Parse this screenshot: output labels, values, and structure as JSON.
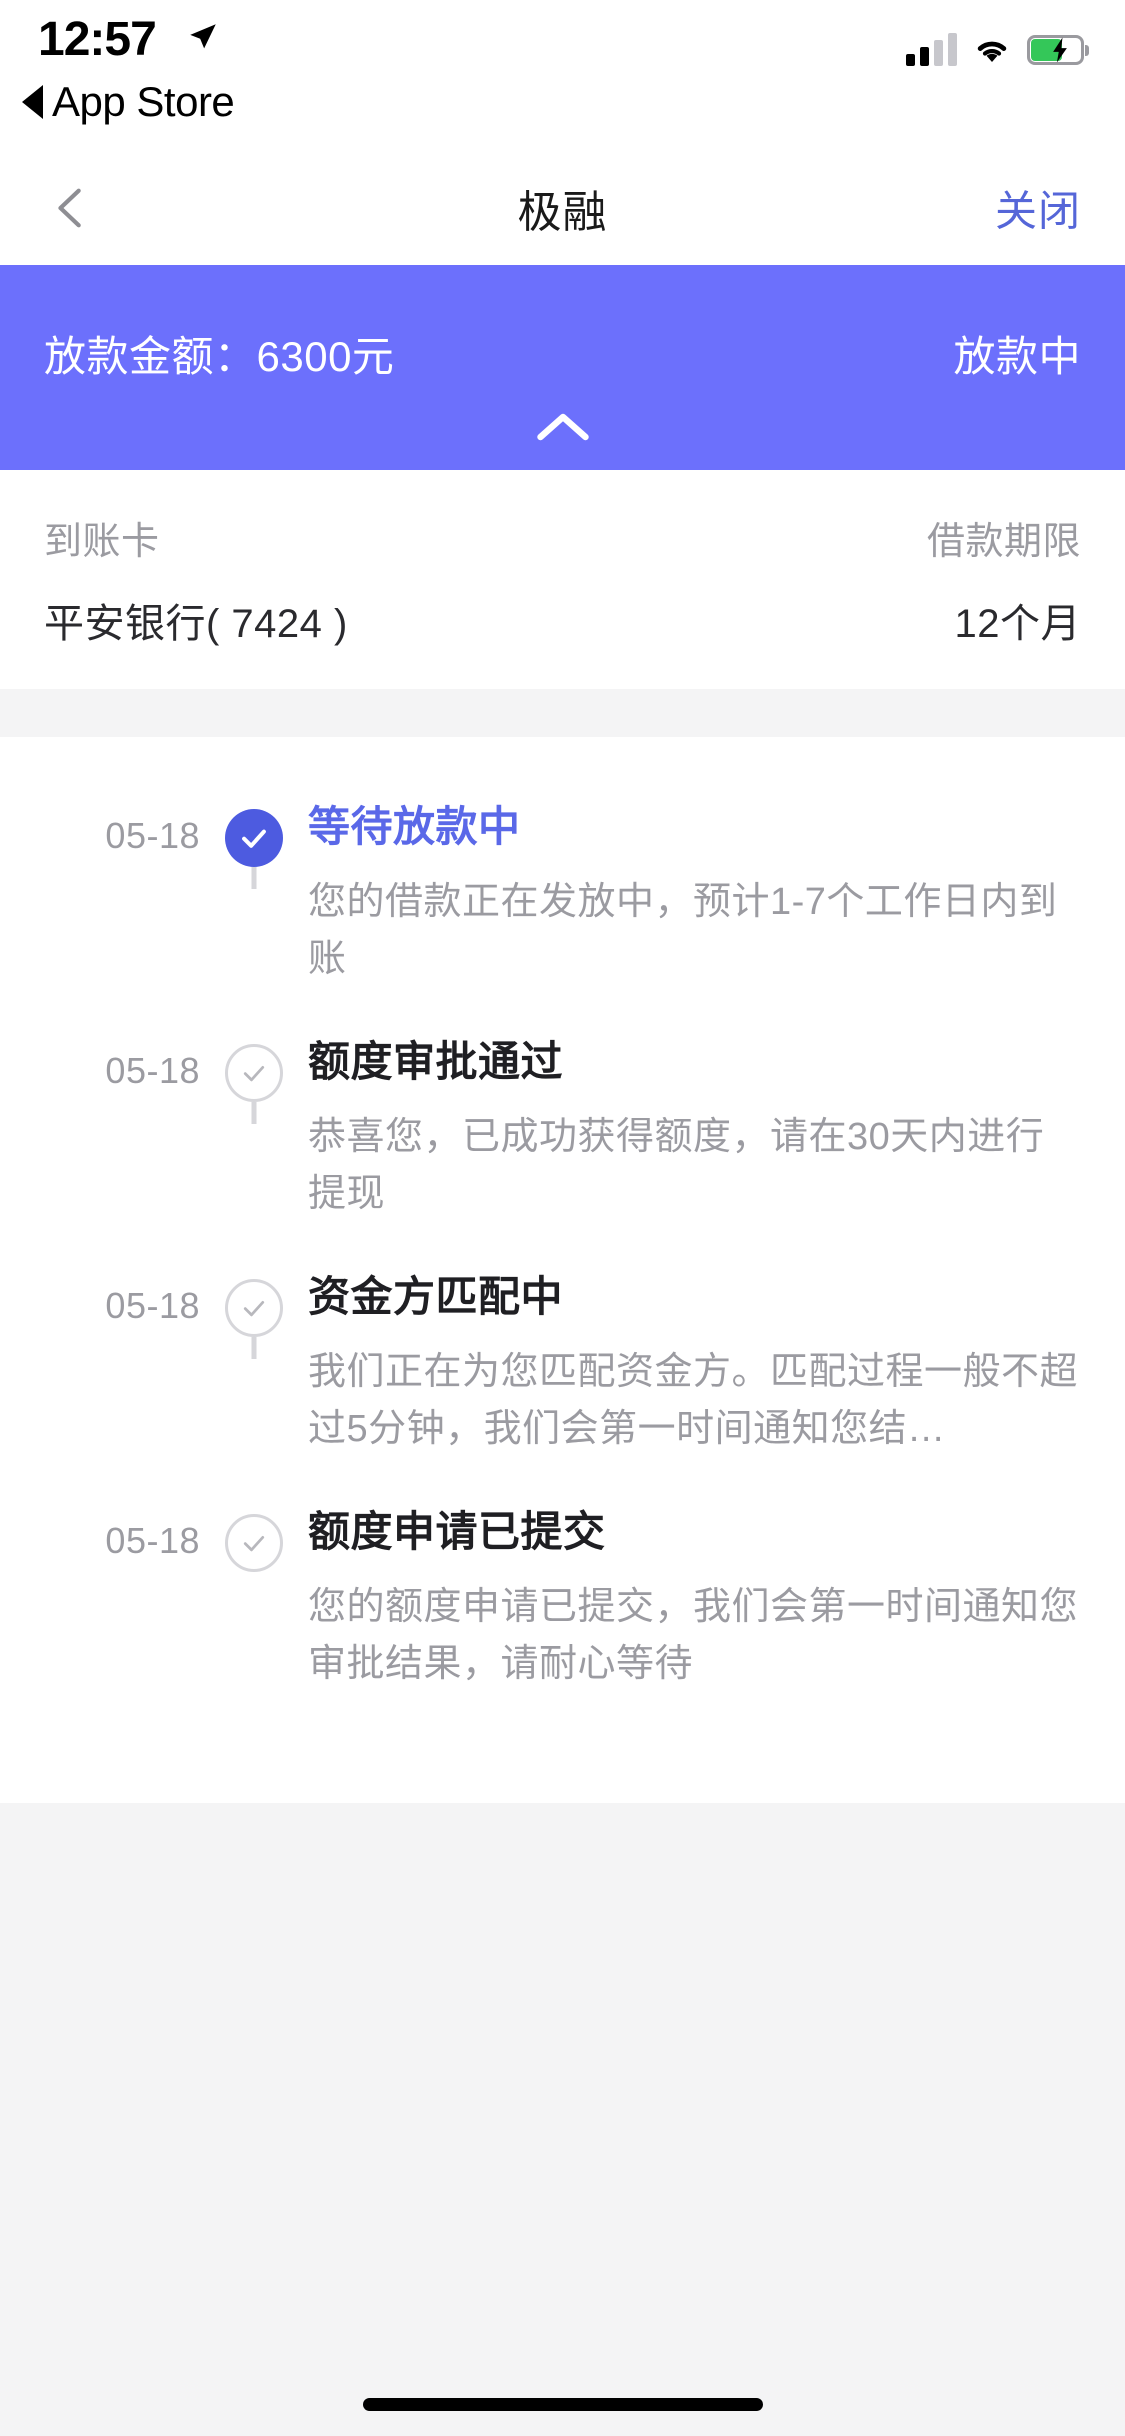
{
  "status_bar": {
    "time": "12:57",
    "back_app_label": "App Store",
    "location_icon": "location-arrow-icon",
    "signal_icon": "cellular-signal-icon",
    "wifi_icon": "wifi-icon",
    "battery_icon": "battery-charging-icon"
  },
  "nav": {
    "back_icon": "chevron-left-icon",
    "title": "极融",
    "close_label": "关闭"
  },
  "banner": {
    "amount_text": "放款金额：6300元",
    "status_text": "放款中",
    "collapse_icon": "chevron-up-icon",
    "bg_color": "#6c70fc"
  },
  "info": {
    "rows": [
      {
        "label": "到账卡",
        "value": "平安银行( 7424 )"
      },
      {
        "label": "借款期限",
        "value": "12个月"
      }
    ]
  },
  "timeline": {
    "items": [
      {
        "date": "05-18",
        "title": "等待放款中",
        "desc": "您的借款正在发放中，预计1-7个工作日内到账",
        "state": "active",
        "icon": "check-circle-filled-icon"
      },
      {
        "date": "05-18",
        "title": "额度审批通过",
        "desc": "恭喜您，已成功获得额度，请在30天内进行提现",
        "state": "done",
        "icon": "check-circle-outline-icon"
      },
      {
        "date": "05-18",
        "title": "资金方匹配中",
        "desc": "我们正在为您匹配资金方。匹配过程一般不超过5分钟，我们会第一时间通知您结…",
        "state": "done",
        "icon": "check-circle-outline-icon"
      },
      {
        "date": "05-18",
        "title": "额度申请已提交",
        "desc": "您的额度申请已提交，我们会第一时间通知您审批结果，请耐心等待",
        "state": "done",
        "icon": "check-circle-outline-icon"
      }
    ]
  },
  "colors": {
    "accent": "#4d5be0",
    "banner": "#6c70fc",
    "link": "#5566d8",
    "muted": "#9b9ba1",
    "page_bg": "#f4f4f5"
  }
}
